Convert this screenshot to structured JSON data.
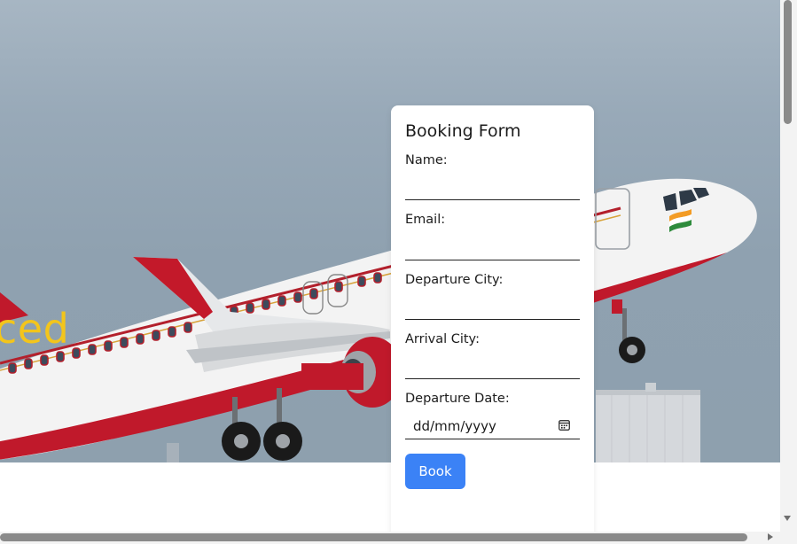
{
  "hero": {
    "partial_text": "ced",
    "accent_color": "#f3c51b",
    "image_subject": "airplane-takeoff-image"
  },
  "booking_form": {
    "title": "Booking Form",
    "fields": [
      {
        "label": "Name:",
        "value": "",
        "placeholder": ""
      },
      {
        "label": "Email:",
        "value": "",
        "placeholder": ""
      },
      {
        "label": "Departure City:",
        "value": "",
        "placeholder": ""
      },
      {
        "label": "Arrival City:",
        "value": "",
        "placeholder": ""
      }
    ],
    "departure_date": {
      "label": "Departure Date:",
      "value": "dd/mm/yyyy",
      "icon": "calendar-icon"
    },
    "submit_label": "Book",
    "button_color": "#3b82f6"
  },
  "scrollbars": {
    "vertical": "vertical-scrollbar",
    "horizontal": "horizontal-scrollbar"
  }
}
